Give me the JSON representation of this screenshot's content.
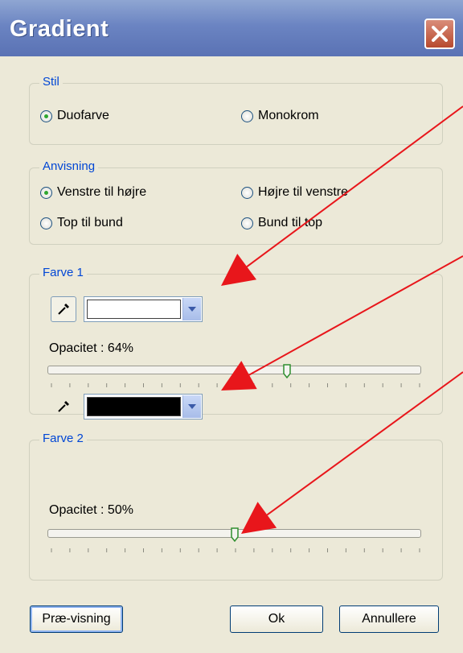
{
  "window": {
    "title": "Gradient"
  },
  "style_group": {
    "legend": "Stil",
    "options": [
      {
        "label": "Duofarve",
        "selected": true
      },
      {
        "label": "Monokrom",
        "selected": false
      }
    ]
  },
  "direction_group": {
    "legend": "Anvisning",
    "options": [
      {
        "label": "Venstre til højre",
        "selected": true
      },
      {
        "label": "Højre til venstre",
        "selected": false
      },
      {
        "label": "Top til bund",
        "selected": false
      },
      {
        "label": "Bund til top",
        "selected": false
      }
    ]
  },
  "color1": {
    "legend": "Farve 1",
    "swatch_color": "#ffffff",
    "opacity_label": "Opacitet : 64%",
    "opacity_value": 0.64
  },
  "color2": {
    "legend": "Farve 2",
    "swatch_color": "#000000",
    "opacity_label": "Opacitet : 50%",
    "opacity_value": 0.5
  },
  "buttons": {
    "preview": "Præ-visning",
    "ok": "Ok",
    "cancel": "Annullere"
  },
  "icons": {
    "close": "close-icon",
    "eyedropper": "eyedropper-icon",
    "dropdown": "chevron-down-icon"
  },
  "annotation_color": "#e8161b"
}
